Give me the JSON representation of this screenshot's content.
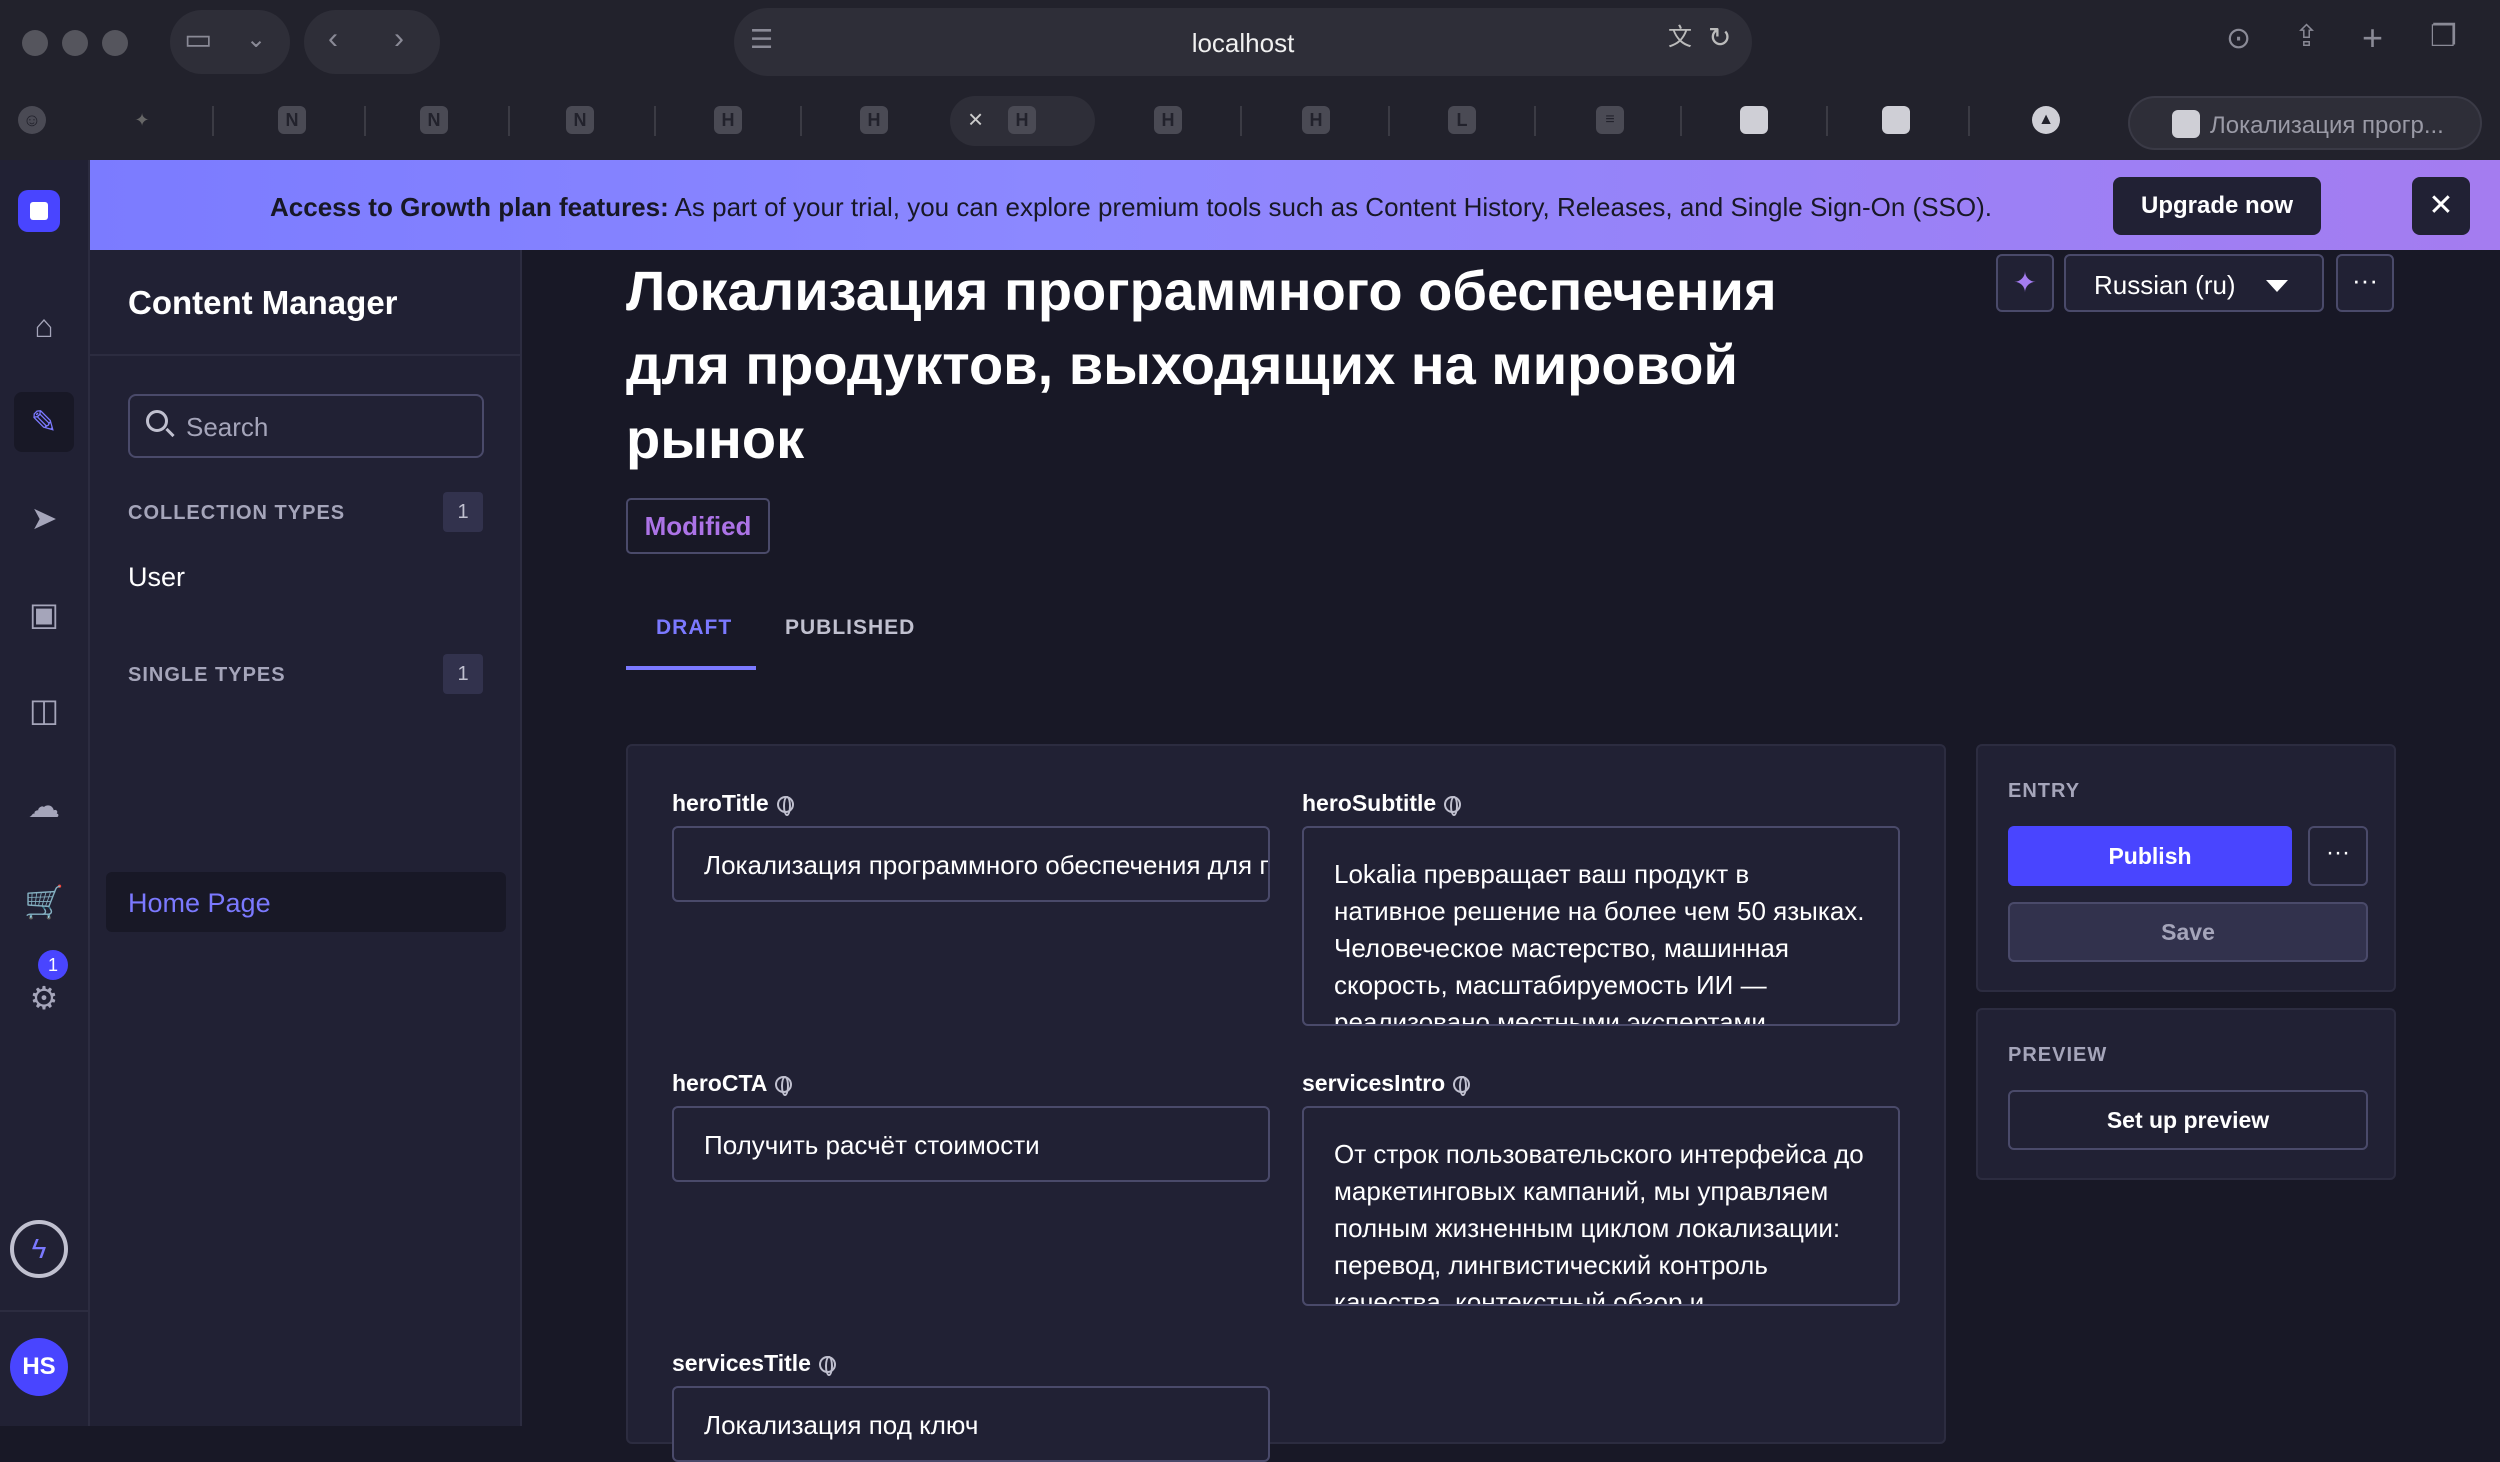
{
  "browser": {
    "url": "localhost",
    "tab_favicons": [
      "N",
      "N",
      "N",
      "H",
      "H",
      "H",
      "H",
      "H",
      "L"
    ],
    "last_tab_title": "Локализация прогр..."
  },
  "banner": {
    "bold": "Access to Growth plan features:",
    "text": " As part of your trial, you can explore premium tools such as Content History, Releases, and Single Sign-On (SSO).",
    "button": "Upgrade now"
  },
  "mainnav": {
    "badge_count": "1",
    "avatar_initials": "HS"
  },
  "subnav": {
    "title": "Content Manager",
    "search_placeholder": "Search",
    "collection_types_label": "COLLECTION TYPES",
    "collection_types_count": "1",
    "collection_items": [
      "User"
    ],
    "single_types_label": "SINGLE TYPES",
    "single_types_count": "1",
    "single_items": [
      "Home Page"
    ]
  },
  "header": {
    "title": "Локализация программного обеспечения для продуктов, выходящих на мировой рынок",
    "locale": "Russian (ru)",
    "status": "Modified",
    "tabs": [
      "DRAFT",
      "PUBLISHED"
    ]
  },
  "fields": {
    "heroTitle": {
      "label": "heroTitle",
      "value": "Локализация программного обеспечения для продуктов, выходящих на мировой рынок"
    },
    "heroSubtitle": {
      "label": "heroSubtitle",
      "value": "Lokalia превращает ваш продукт в нативное решение на более чем 50 языках. Человеческое мастерство, машинная скорость, масштабируемость ИИ — реализовано местными экспертами."
    },
    "heroCTA": {
      "label": "heroCTA",
      "value": "Получить расчёт стоимости"
    },
    "servicesIntro": {
      "label": "servicesIntro",
      "value": "От строк пользовательского интерфейса до маркетинговых кампаний, мы управляем полным жизненным циклом локализации: перевод, лингвистический контроль качества, контекстный обзор и"
    },
    "servicesTitle": {
      "label": "servicesTitle",
      "value": "Локализация под ключ"
    }
  },
  "entry": {
    "label": "ENTRY",
    "publish": "Publish",
    "save": "Save"
  },
  "preview": {
    "label": "PREVIEW",
    "button": "Set up preview"
  },
  "colors": {
    "primary": "#4945ff",
    "primary_text": "#7b79ff",
    "background": "#181826",
    "surface": "#212134",
    "modified": "#ac73e6"
  }
}
